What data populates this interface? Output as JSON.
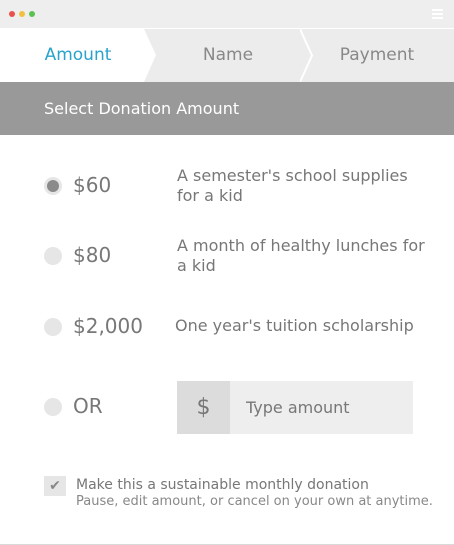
{
  "steps": {
    "amount": "Amount",
    "name": "Name",
    "payment": "Payment"
  },
  "section": {
    "title": "Select Donation Amount"
  },
  "options": [
    {
      "amount": "$60",
      "description": "A semester's school supplies for a kid",
      "selected": true
    },
    {
      "amount": "$80",
      "description": "A month of healthy lunches for a kid",
      "selected": false
    },
    {
      "amount": "$2,000",
      "description": "One year's tuition scholarship",
      "selected": false
    }
  ],
  "custom": {
    "label": "OR",
    "currency": "$",
    "placeholder": "Type amount"
  },
  "monthly": {
    "checked": true,
    "check_glyph": "✔",
    "title": "Make this a sustainable monthly donation",
    "subtitle": "Pause, edit amount, or cancel on your own at anytime."
  },
  "colors": {
    "accent": "#29a3cc",
    "header_bg": "#999999",
    "radio_fill": "#8a8a8a"
  },
  "icons": {
    "menu": "hamburger-menu-icon",
    "window_controls": [
      "close-dot-icon",
      "minimize-dot-icon",
      "maximize-dot-icon"
    ],
    "checkmark": "checkmark-icon"
  }
}
